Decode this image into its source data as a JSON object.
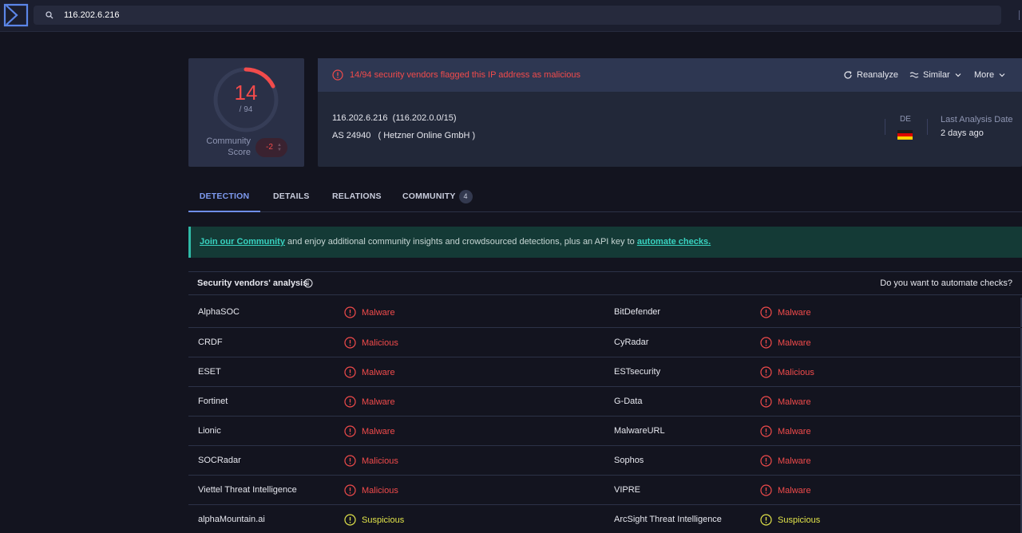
{
  "search": {
    "value": "116.202.6.216"
  },
  "score": {
    "detections": "14",
    "total": "/ 94",
    "community_label": "Community Score",
    "community_value": "-2"
  },
  "alert": {
    "text": "14/94 security vendors flagged this IP address as malicious",
    "reanalyze": "Reanalyze",
    "similar": "Similar",
    "more": "More"
  },
  "ip_info": {
    "ip": "116.202.6.216",
    "range": "(116.202.0.0/15)",
    "as": "AS 24940",
    "as_owner": "( Hetzner Online GmbH )",
    "country": "DE",
    "last_analysis_label": "Last Analysis Date",
    "last_analysis_value": "2 days ago"
  },
  "tabs": [
    {
      "label": "DETECTION"
    },
    {
      "label": "DETAILS"
    },
    {
      "label": "RELATIONS"
    },
    {
      "label": "COMMUNITY",
      "count": "4"
    }
  ],
  "banner": {
    "link1": "Join our Community",
    "middle": " and enjoy additional community insights and crowdsourced detections, plus an API key to ",
    "link2": "automate checks."
  },
  "analysis": {
    "title": "Security vendors' analysis",
    "automate_question": "Do you want to automate checks?"
  },
  "vendors": [
    [
      {
        "name": "AlphaSOC",
        "result": "Malware",
        "level": "malicious"
      },
      {
        "name": "BitDefender",
        "result": "Malware",
        "level": "malicious"
      }
    ],
    [
      {
        "name": "CRDF",
        "result": "Malicious",
        "level": "malicious"
      },
      {
        "name": "CyRadar",
        "result": "Malware",
        "level": "malicious"
      }
    ],
    [
      {
        "name": "ESET",
        "result": "Malware",
        "level": "malicious"
      },
      {
        "name": "ESTsecurity",
        "result": "Malicious",
        "level": "malicious"
      }
    ],
    [
      {
        "name": "Fortinet",
        "result": "Malware",
        "level": "malicious"
      },
      {
        "name": "G-Data",
        "result": "Malware",
        "level": "malicious"
      }
    ],
    [
      {
        "name": "Lionic",
        "result": "Malware",
        "level": "malicious"
      },
      {
        "name": "MalwareURL",
        "result": "Malware",
        "level": "malicious"
      }
    ],
    [
      {
        "name": "SOCRadar",
        "result": "Malicious",
        "level": "malicious"
      },
      {
        "name": "Sophos",
        "result": "Malware",
        "level": "malicious"
      }
    ],
    [
      {
        "name": "Viettel Threat Intelligence",
        "result": "Malicious",
        "level": "malicious"
      },
      {
        "name": "VIPRE",
        "result": "Malware",
        "level": "malicious"
      }
    ],
    [
      {
        "name": "alphaMountain.ai",
        "result": "Suspicious",
        "level": "suspicious"
      },
      {
        "name": "ArcSight Threat Intelligence",
        "result": "Suspicious",
        "level": "suspicious"
      }
    ]
  ],
  "colors": {
    "malicious": "#f24b4b",
    "suspicious": "#e2e44a",
    "accent": "#6f8ee8"
  }
}
